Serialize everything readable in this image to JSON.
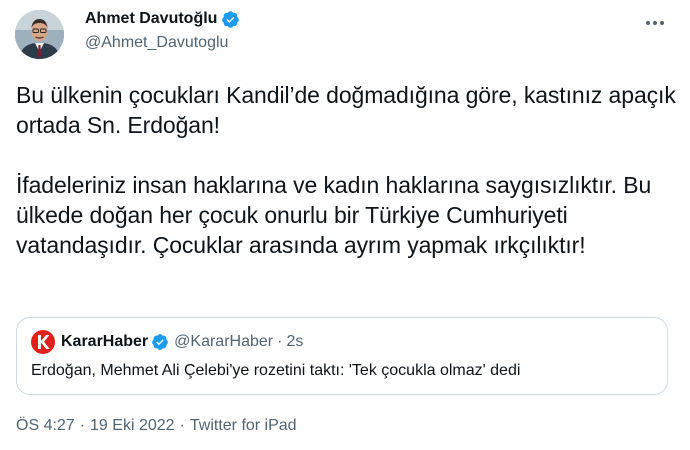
{
  "author": {
    "display_name": "Ahmet Davutoğlu",
    "handle": "@Ahmet_Davutoglu",
    "verified_icon": "verified-badge-icon",
    "accent_color": "#1d9bf0"
  },
  "tweet": {
    "paragraphs": [
      "Bu ülkenin çocukları Kandil’de doğmadığına göre, kastınız apaçık ortada Sn. Erdoğan!",
      "İfadeleriniz insan haklarına ve kadın haklarına saygısızlıktır. Bu ülkede doğan her çocuk onurlu bir Türkiye Cumhuriyeti vatandaşıdır. Çocuklar arasında ayrım yapmak ırkçılıktır!"
    ]
  },
  "quote": {
    "logo_icon": "kararhaber-logo-icon",
    "logo_color": "#e0201b",
    "display_name": "KararHaber",
    "handle": "@KararHaber",
    "separator": "·",
    "time": "2s",
    "text": "Erdoğan, Mehmet Ali Çelebi'ye rozetini taktı: 'Tek çocukla olmaz' dedi"
  },
  "meta": {
    "time": "ÖS 4:27",
    "separator": "·",
    "date": "19 Eki 2022",
    "source": "Twitter for iPad"
  }
}
